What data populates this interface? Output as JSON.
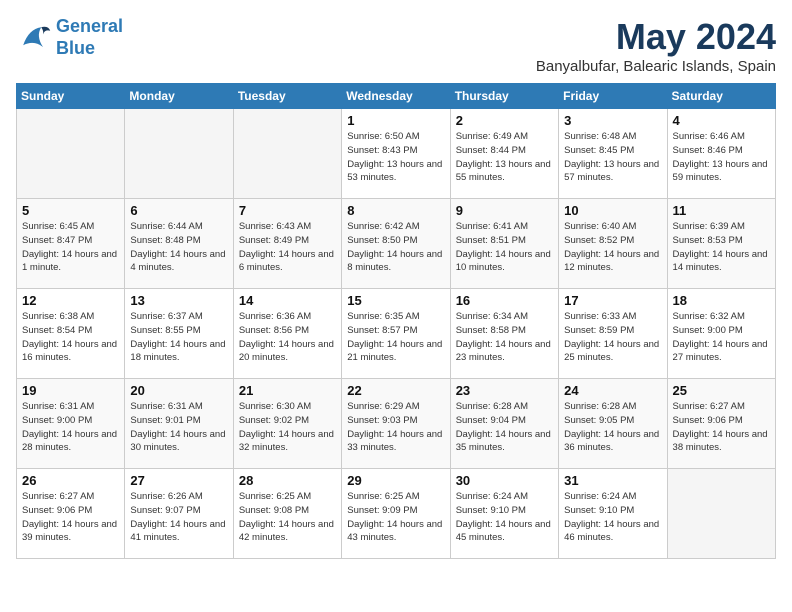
{
  "header": {
    "logo_line1": "General",
    "logo_line2": "Blue",
    "month": "May 2024",
    "location": "Banyalbufar, Balearic Islands, Spain"
  },
  "days_of_week": [
    "Sunday",
    "Monday",
    "Tuesday",
    "Wednesday",
    "Thursday",
    "Friday",
    "Saturday"
  ],
  "weeks": [
    [
      {
        "num": "",
        "info": ""
      },
      {
        "num": "",
        "info": ""
      },
      {
        "num": "",
        "info": ""
      },
      {
        "num": "1",
        "info": "Sunrise: 6:50 AM\nSunset: 8:43 PM\nDaylight: 13 hours and 53 minutes."
      },
      {
        "num": "2",
        "info": "Sunrise: 6:49 AM\nSunset: 8:44 PM\nDaylight: 13 hours and 55 minutes."
      },
      {
        "num": "3",
        "info": "Sunrise: 6:48 AM\nSunset: 8:45 PM\nDaylight: 13 hours and 57 minutes."
      },
      {
        "num": "4",
        "info": "Sunrise: 6:46 AM\nSunset: 8:46 PM\nDaylight: 13 hours and 59 minutes."
      }
    ],
    [
      {
        "num": "5",
        "info": "Sunrise: 6:45 AM\nSunset: 8:47 PM\nDaylight: 14 hours and 1 minute."
      },
      {
        "num": "6",
        "info": "Sunrise: 6:44 AM\nSunset: 8:48 PM\nDaylight: 14 hours and 4 minutes."
      },
      {
        "num": "7",
        "info": "Sunrise: 6:43 AM\nSunset: 8:49 PM\nDaylight: 14 hours and 6 minutes."
      },
      {
        "num": "8",
        "info": "Sunrise: 6:42 AM\nSunset: 8:50 PM\nDaylight: 14 hours and 8 minutes."
      },
      {
        "num": "9",
        "info": "Sunrise: 6:41 AM\nSunset: 8:51 PM\nDaylight: 14 hours and 10 minutes."
      },
      {
        "num": "10",
        "info": "Sunrise: 6:40 AM\nSunset: 8:52 PM\nDaylight: 14 hours and 12 minutes."
      },
      {
        "num": "11",
        "info": "Sunrise: 6:39 AM\nSunset: 8:53 PM\nDaylight: 14 hours and 14 minutes."
      }
    ],
    [
      {
        "num": "12",
        "info": "Sunrise: 6:38 AM\nSunset: 8:54 PM\nDaylight: 14 hours and 16 minutes."
      },
      {
        "num": "13",
        "info": "Sunrise: 6:37 AM\nSunset: 8:55 PM\nDaylight: 14 hours and 18 minutes."
      },
      {
        "num": "14",
        "info": "Sunrise: 6:36 AM\nSunset: 8:56 PM\nDaylight: 14 hours and 20 minutes."
      },
      {
        "num": "15",
        "info": "Sunrise: 6:35 AM\nSunset: 8:57 PM\nDaylight: 14 hours and 21 minutes."
      },
      {
        "num": "16",
        "info": "Sunrise: 6:34 AM\nSunset: 8:58 PM\nDaylight: 14 hours and 23 minutes."
      },
      {
        "num": "17",
        "info": "Sunrise: 6:33 AM\nSunset: 8:59 PM\nDaylight: 14 hours and 25 minutes."
      },
      {
        "num": "18",
        "info": "Sunrise: 6:32 AM\nSunset: 9:00 PM\nDaylight: 14 hours and 27 minutes."
      }
    ],
    [
      {
        "num": "19",
        "info": "Sunrise: 6:31 AM\nSunset: 9:00 PM\nDaylight: 14 hours and 28 minutes."
      },
      {
        "num": "20",
        "info": "Sunrise: 6:31 AM\nSunset: 9:01 PM\nDaylight: 14 hours and 30 minutes."
      },
      {
        "num": "21",
        "info": "Sunrise: 6:30 AM\nSunset: 9:02 PM\nDaylight: 14 hours and 32 minutes."
      },
      {
        "num": "22",
        "info": "Sunrise: 6:29 AM\nSunset: 9:03 PM\nDaylight: 14 hours and 33 minutes."
      },
      {
        "num": "23",
        "info": "Sunrise: 6:28 AM\nSunset: 9:04 PM\nDaylight: 14 hours and 35 minutes."
      },
      {
        "num": "24",
        "info": "Sunrise: 6:28 AM\nSunset: 9:05 PM\nDaylight: 14 hours and 36 minutes."
      },
      {
        "num": "25",
        "info": "Sunrise: 6:27 AM\nSunset: 9:06 PM\nDaylight: 14 hours and 38 minutes."
      }
    ],
    [
      {
        "num": "26",
        "info": "Sunrise: 6:27 AM\nSunset: 9:06 PM\nDaylight: 14 hours and 39 minutes."
      },
      {
        "num": "27",
        "info": "Sunrise: 6:26 AM\nSunset: 9:07 PM\nDaylight: 14 hours and 41 minutes."
      },
      {
        "num": "28",
        "info": "Sunrise: 6:25 AM\nSunset: 9:08 PM\nDaylight: 14 hours and 42 minutes."
      },
      {
        "num": "29",
        "info": "Sunrise: 6:25 AM\nSunset: 9:09 PM\nDaylight: 14 hours and 43 minutes."
      },
      {
        "num": "30",
        "info": "Sunrise: 6:24 AM\nSunset: 9:10 PM\nDaylight: 14 hours and 45 minutes."
      },
      {
        "num": "31",
        "info": "Sunrise: 6:24 AM\nSunset: 9:10 PM\nDaylight: 14 hours and 46 minutes."
      },
      {
        "num": "",
        "info": ""
      }
    ]
  ]
}
